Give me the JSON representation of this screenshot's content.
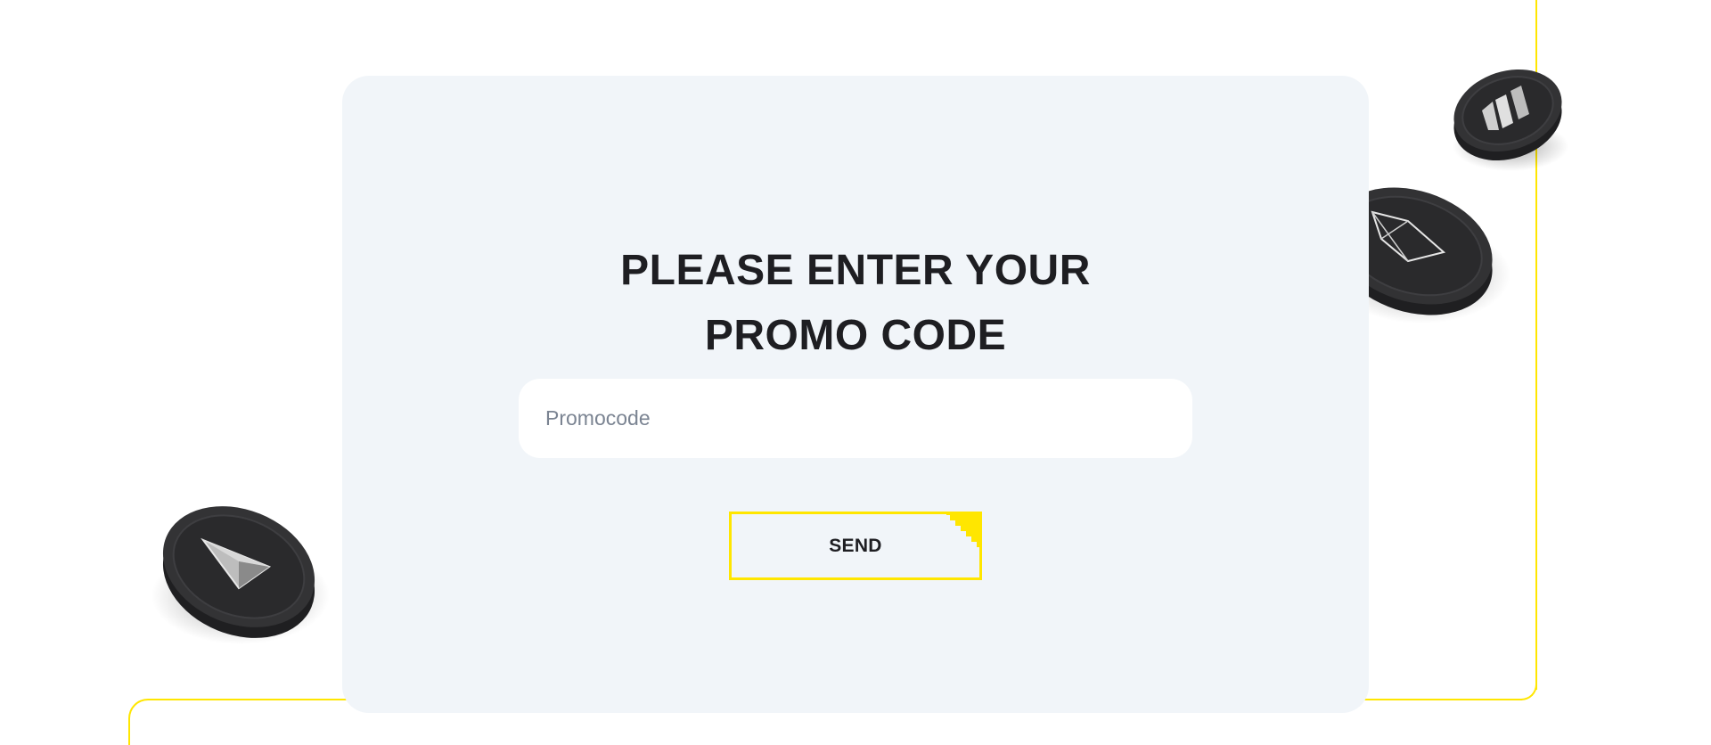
{
  "promo": {
    "title_line1": "PLEASE ENTER YOUR",
    "title_line2": "PROMO CODE",
    "input_placeholder": "Promocode",
    "input_value": "",
    "send_label": "SEND"
  },
  "colors": {
    "accent": "#ffe600",
    "card_bg": "#f1f5f9",
    "text": "#1e1e22",
    "placeholder": "#7b8492",
    "coin": "#2e2e30"
  },
  "icons": {
    "coin_left": "ethereum-coin-icon",
    "coin_right_big": "diamond-coin-icon",
    "coin_right_small": "stripes-coin-icon"
  }
}
